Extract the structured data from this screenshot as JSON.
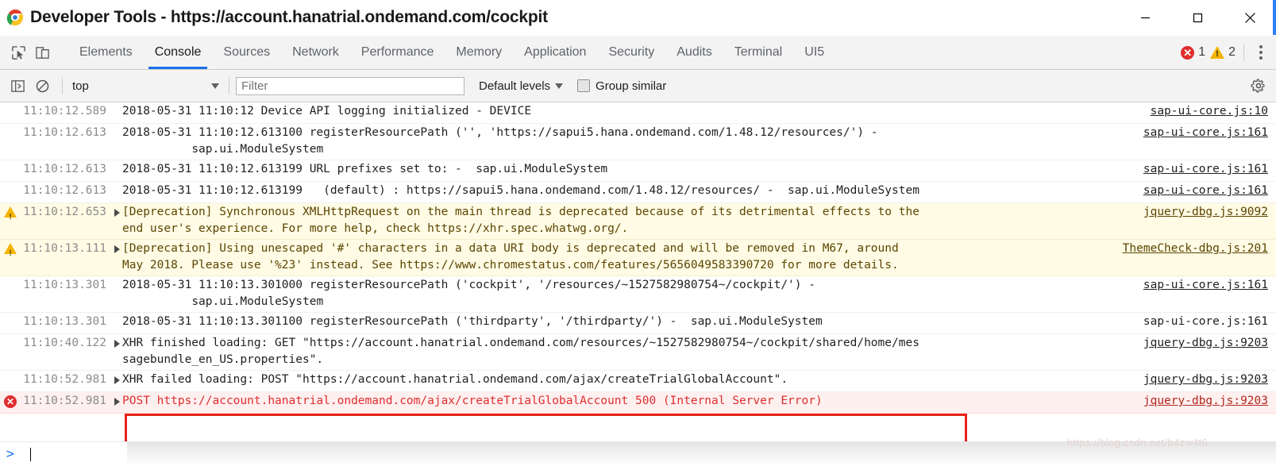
{
  "window": {
    "title": "Developer Tools - https://account.hanatrial.ondemand.com/cockpit",
    "logo_icon": "chrome-logo-icon",
    "minimize_icon": "minimize-icon",
    "maximize_icon": "maximize-icon",
    "close_icon": "close-icon"
  },
  "tabstrip": {
    "inspect_icon": "inspect-element-icon",
    "device_icon": "toggle-device-toolbar-icon",
    "tabs": [
      {
        "label": "Elements",
        "active": false
      },
      {
        "label": "Console",
        "active": true
      },
      {
        "label": "Sources",
        "active": false
      },
      {
        "label": "Network",
        "active": false
      },
      {
        "label": "Performance",
        "active": false
      },
      {
        "label": "Memory",
        "active": false
      },
      {
        "label": "Application",
        "active": false
      },
      {
        "label": "Security",
        "active": false
      },
      {
        "label": "Audits",
        "active": false
      },
      {
        "label": "Terminal",
        "active": false
      },
      {
        "label": "UI5",
        "active": false
      }
    ],
    "error_count": "1",
    "warning_count": "2",
    "error_icon": "error-circle-icon",
    "warning_icon": "warning-triangle-icon",
    "menu_icon": "kebab-menu-icon"
  },
  "console_toolbar": {
    "clear_icon": "clear-console-icon",
    "sidebar_icon": "console-sidebar-icon",
    "context": "top",
    "filter_placeholder": "Filter",
    "filter_value": "",
    "levels_label": "Default levels",
    "group_similar_label": "Group similar",
    "group_similar_checked": false,
    "settings_icon": "gear-icon"
  },
  "console_rows": [
    {
      "level": "info",
      "icon": "",
      "timestamp": "11:10:12.589",
      "expandable": false,
      "message": "2018-05-31 11:10:12 Device API logging initialized - DEVICE",
      "source": "sap-ui-core.js:10"
    },
    {
      "level": "info",
      "icon": "",
      "timestamp": "11:10:12.613",
      "expandable": false,
      "message": "2018-05-31 11:10:12.613100 registerResourcePath ('', 'https://sapui5.hana.ondemand.com/1.48.12/resources/') -\n          sap.ui.ModuleSystem",
      "source": "sap-ui-core.js:161"
    },
    {
      "level": "info",
      "icon": "",
      "timestamp": "11:10:12.613",
      "expandable": false,
      "message": "2018-05-31 11:10:12.613199 URL prefixes set to: -  sap.ui.ModuleSystem",
      "source": "sap-ui-core.js:161"
    },
    {
      "level": "info",
      "icon": "",
      "timestamp": "11:10:12.613",
      "expandable": false,
      "message": "2018-05-31 11:10:12.613199   (default) : https://sapui5.hana.ondemand.com/1.48.12/resources/ -  sap.ui.ModuleSystem",
      "source": "sap-ui-core.js:161"
    },
    {
      "level": "warning",
      "icon": "warning-triangle-icon",
      "timestamp": "11:10:12.653",
      "expandable": true,
      "message": "[Deprecation] Synchronous XMLHttpRequest on the main thread is deprecated because of its detrimental effects to the\nend user's experience. For more help, check https://xhr.spec.whatwg.org/.",
      "source": "jquery-dbg.js:9092"
    },
    {
      "level": "warning",
      "icon": "warning-triangle-icon",
      "timestamp": "11:10:13.111",
      "expandable": true,
      "message": "[Deprecation] Using unescaped '#' characters in a data URI body is deprecated and will be removed in M67, around\nMay 2018. Please use '%23' instead. See https://www.chromestatus.com/features/5656049583390720 for more details.",
      "source": "ThemeCheck-dbg.js:201"
    },
    {
      "level": "info",
      "icon": "",
      "timestamp": "11:10:13.301",
      "expandable": false,
      "message": "2018-05-31 11:10:13.301000 registerResourcePath ('cockpit', '/resources/~1527582980754~/cockpit/') -\n          sap.ui.ModuleSystem",
      "source": "sap-ui-core.js:161"
    },
    {
      "level": "info",
      "icon": "",
      "timestamp": "11:10:13.301",
      "expandable": false,
      "message": "2018-05-31 11:10:13.301100 registerResourcePath ('thirdparty', '/thirdparty/') -  sap.ui.ModuleSystem",
      "source": "sap-ui-core.js:161"
    },
    {
      "level": "info",
      "icon": "",
      "timestamp": "11:10:40.122",
      "expandable": true,
      "message": "XHR finished loading: GET \"https://account.hanatrial.ondemand.com/resources/~1527582980754~/cockpit/shared/home/mes\nsagebundle_en_US.properties\".",
      "source": "jquery-dbg.js:9203"
    },
    {
      "level": "info",
      "icon": "",
      "timestamp": "11:10:52.981",
      "expandable": true,
      "message": "XHR failed loading: POST \"https://account.hanatrial.ondemand.com/ajax/createTrialGlobalAccount\".",
      "source": "jquery-dbg.js:9203"
    },
    {
      "level": "error",
      "icon": "error-circle-icon",
      "timestamp": "11:10:52.981",
      "expandable": true,
      "message": "POST https://account.hanatrial.ondemand.com/ajax/createTrialGlobalAccount 500 (Internal Server Error)",
      "source": "jquery-dbg.js:9203"
    }
  ],
  "prompt": {
    "caret": ">",
    "value": ""
  },
  "watermark": "https://blog.csdn.net/b4zw4t6",
  "colors": {
    "accent": "#1a73e8",
    "error": "#e02d2d",
    "warning": "#f5b400",
    "error_row_bg": "#fff0f0",
    "warning_row_bg": "#fffbe5",
    "highlight_border": "#e8211b"
  }
}
